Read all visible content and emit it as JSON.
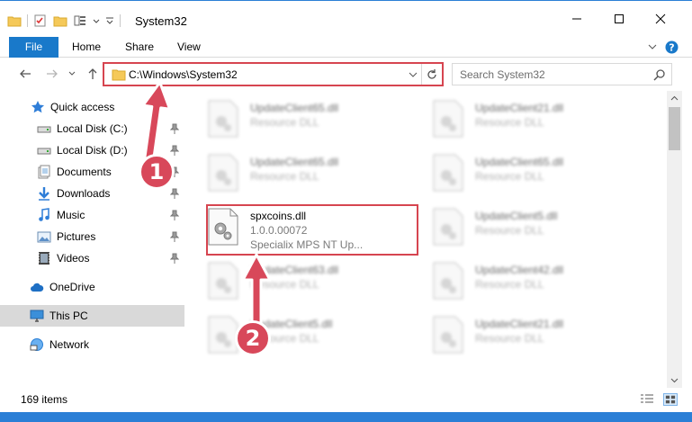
{
  "window": {
    "title": "System32"
  },
  "ribbon": {
    "tabs": [
      "File",
      "Home",
      "Share",
      "View"
    ]
  },
  "address": {
    "path": "C:\\Windows\\System32"
  },
  "search": {
    "placeholder": "Search System32"
  },
  "sidebar": {
    "items": [
      {
        "label": "Quick access",
        "icon": "star-icon"
      },
      {
        "label": "Local Disk (C:)",
        "icon": "drive-icon"
      },
      {
        "label": "Local Disk (D:)",
        "icon": "drive-icon"
      },
      {
        "label": "Documents",
        "icon": "documents-icon"
      },
      {
        "label": "Downloads",
        "icon": "downloads-icon"
      },
      {
        "label": "Music",
        "icon": "music-icon"
      },
      {
        "label": "Pictures",
        "icon": "pictures-icon"
      },
      {
        "label": "Videos",
        "icon": "videos-icon"
      },
      {
        "label": "OneDrive",
        "icon": "cloud-icon"
      },
      {
        "label": "This PC",
        "icon": "computer-icon"
      },
      {
        "label": "Network",
        "icon": "network-icon"
      }
    ]
  },
  "files": [
    {
      "name": "UpdateClient65.dll",
      "type": "Resource DLL"
    },
    {
      "name": "UpdateClient21.dll",
      "type": "Resource DLL"
    },
    {
      "name": "UpdateClient65.dll",
      "type": "Resource DLL"
    },
    {
      "name": "UpdateClient65.dll",
      "type": "Resource DLL"
    },
    {
      "name": "spxcoins.dll",
      "version": "1.0.0.00072",
      "description": "Specialix MPS NT Up..."
    },
    {
      "name": "UpdateClient5.dll",
      "type": "Resource DLL"
    },
    {
      "name": "UpdateClient63.dll",
      "type": "Resource DLL"
    },
    {
      "name": "UpdateClient42.dll",
      "type": "Resource DLL"
    },
    {
      "name": "UpdateClient5.dll",
      "type": "Resource DLL"
    },
    {
      "name": "UpdateClient21.dll",
      "type": "Resource DLL"
    }
  ],
  "status": {
    "item_count": "169 items"
  },
  "annotations": {
    "step1": "1",
    "step2": "2"
  },
  "colors": {
    "accent": "#1979ca",
    "highlight": "#d64550",
    "badge": "#d8485a"
  }
}
